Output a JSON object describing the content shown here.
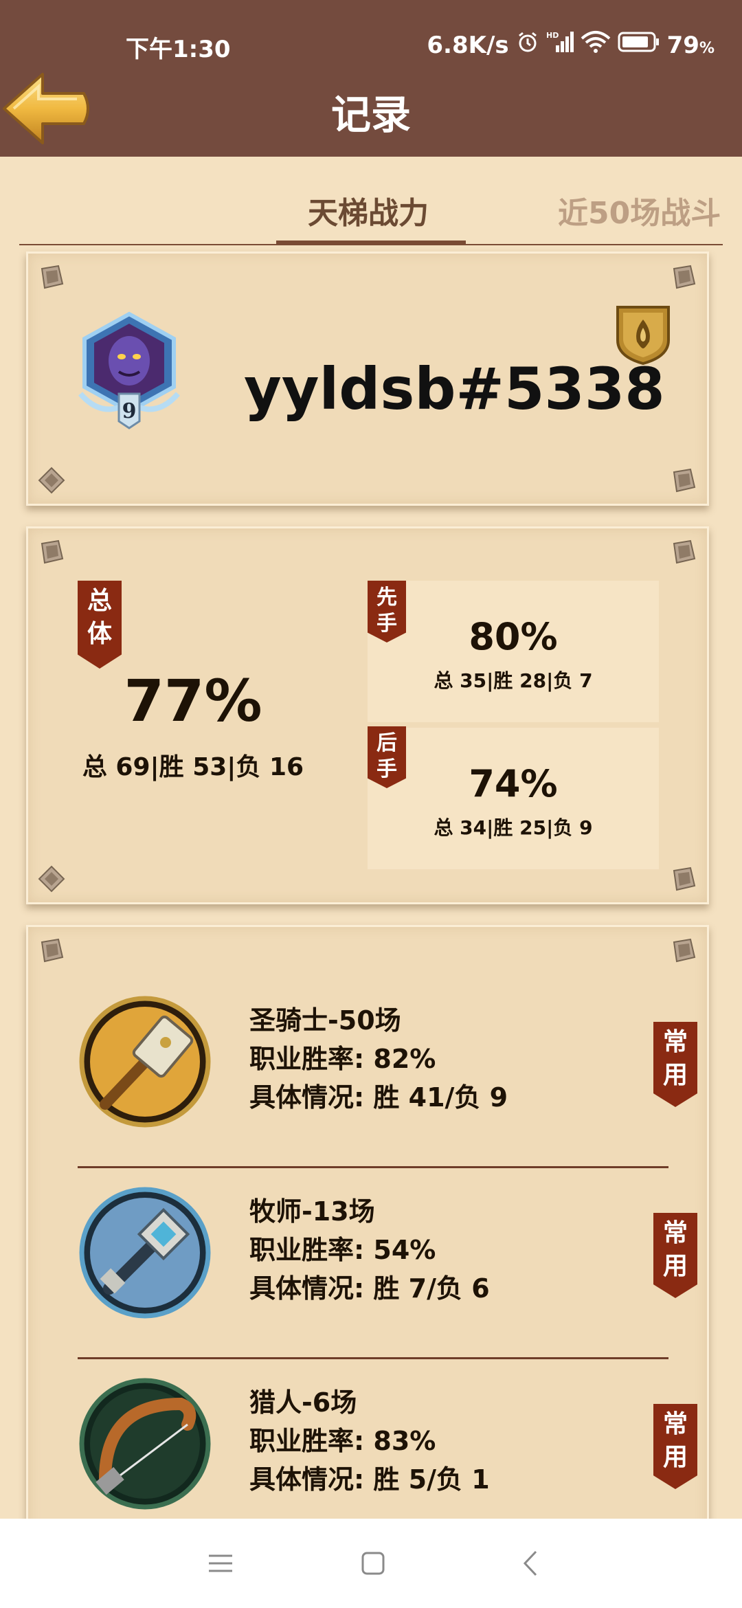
{
  "status_bar": {
    "time": "下午1:30",
    "net_speed": "6.8K/s",
    "battery_pct": "79",
    "battery_unit": "%",
    "icons": [
      "alarm-icon",
      "hd-signal-icon",
      "wifi-icon",
      "battery-icon"
    ]
  },
  "header": {
    "title": "记录",
    "back_icon": "back-arrow-icon"
  },
  "tabs": [
    {
      "label": "天梯战力",
      "active": true
    },
    {
      "label": "近50场战斗",
      "active": false
    }
  ],
  "profile": {
    "username": "yyldsb#5338",
    "rank_level": "9",
    "rank_icon": "rank-medal-icon",
    "class_icon": "class-emblem-icon"
  },
  "stats": {
    "overall": {
      "label": "总体",
      "rate": "77%",
      "summary": "总 69|胜 53|负 16"
    },
    "first": {
      "label": "先手",
      "rate": "80%",
      "summary": "总 35|胜 28|负 7"
    },
    "second": {
      "label": "后手",
      "rate": "74%",
      "summary": "总 34|胜 25|负 9"
    }
  },
  "heroes": [
    {
      "icon": "hammer-icon",
      "title": "圣骑士-50场",
      "winrate": "职业胜率: 82%",
      "detail": "具体情况: 胜 41/负 9",
      "tag": "常用"
    },
    {
      "icon": "mace-icon",
      "title": "牧师-13场",
      "winrate": "职业胜率: 54%",
      "detail": "具体情况: 胜 7/负 6",
      "tag": "常用"
    },
    {
      "icon": "bow-icon",
      "title": "猎人-6场",
      "winrate": "职业胜率: 83%",
      "detail": "具体情况: 胜 5/负 1",
      "tag": "常用"
    }
  ],
  "colors": {
    "header_bg": "#744b3e",
    "page_bg": "#f4e1c1",
    "card_bg": "#f0dbb8",
    "ribbon": "#8a2a12",
    "tab_active": "#6b4a33",
    "tab_inactive": "#bd9f84"
  },
  "navbar": {
    "icons": [
      "menu-icon",
      "home-icon",
      "back-icon"
    ]
  }
}
